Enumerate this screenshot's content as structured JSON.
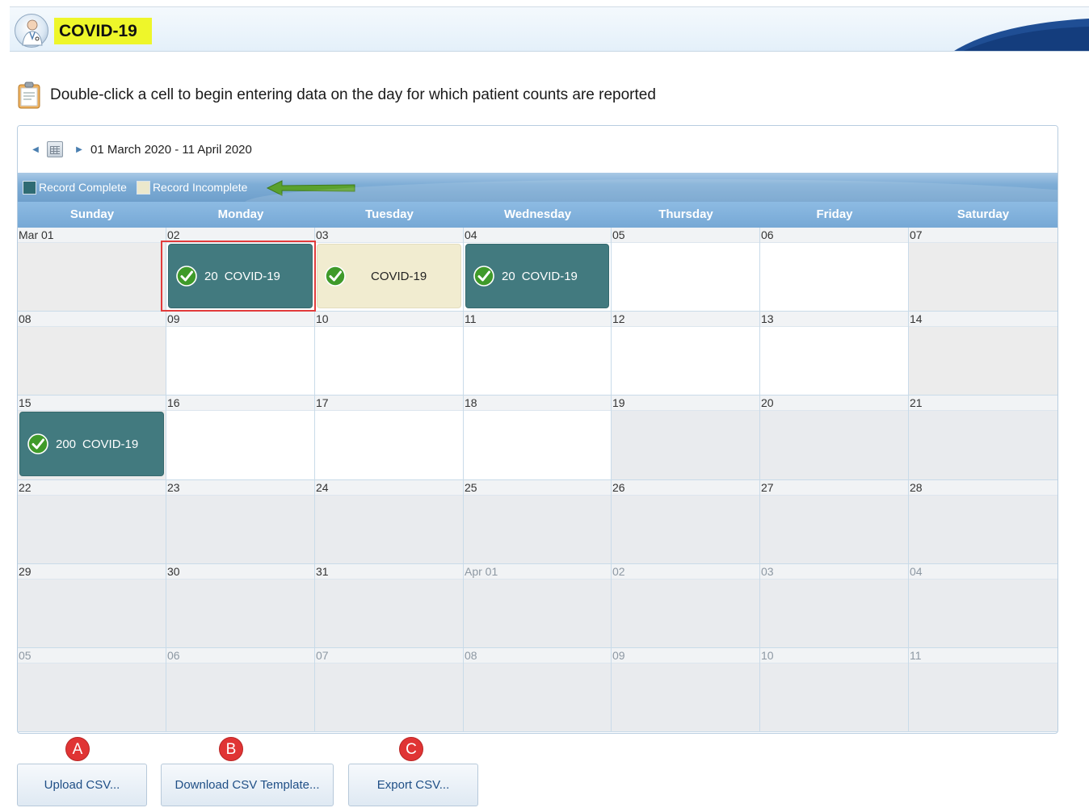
{
  "header": {
    "title": "COVID-19"
  },
  "instruction": {
    "text": "Double-click a cell to begin entering data on the day for which patient counts are reported"
  },
  "calendar": {
    "range": "01 March 2020 - 11 April 2020",
    "legend": [
      {
        "label": "Record Complete",
        "color": "#2f6b73"
      },
      {
        "label": "Record Incomplete",
        "color": "#ece8cc"
      }
    ],
    "days": [
      "Sunday",
      "Monday",
      "Tuesday",
      "Wednesday",
      "Thursday",
      "Friday",
      "Saturday"
    ],
    "weeks": [
      [
        {
          "label": "Mar 01",
          "bg": "gray"
        },
        {
          "label": "02",
          "bg": "white",
          "event": {
            "status": "complete",
            "count": "20",
            "name": "COVID-19"
          }
        },
        {
          "label": "03",
          "bg": "white",
          "event": {
            "status": "incomplete",
            "count": "",
            "name": "COVID-19"
          }
        },
        {
          "label": "04",
          "bg": "white",
          "event": {
            "status": "complete",
            "count": "20",
            "name": "COVID-19"
          }
        },
        {
          "label": "05",
          "bg": "white"
        },
        {
          "label": "06",
          "bg": "white"
        },
        {
          "label": "07",
          "bg": "gray"
        }
      ],
      [
        {
          "label": "08",
          "bg": "gray"
        },
        {
          "label": "09",
          "bg": "white"
        },
        {
          "label": "10",
          "bg": "white"
        },
        {
          "label": "11",
          "bg": "white"
        },
        {
          "label": "12",
          "bg": "white"
        },
        {
          "label": "13",
          "bg": "white"
        },
        {
          "label": "14",
          "bg": "gray"
        }
      ],
      [
        {
          "label": "15",
          "bg": "gray",
          "event": {
            "status": "complete",
            "count": "200",
            "name": "COVID-19"
          }
        },
        {
          "label": "16",
          "bg": "white"
        },
        {
          "label": "17",
          "bg": "white"
        },
        {
          "label": "18",
          "bg": "white"
        },
        {
          "label": "19",
          "bg": "gray-blue"
        },
        {
          "label": "20",
          "bg": "gray-blue"
        },
        {
          "label": "21",
          "bg": "gray-blue"
        }
      ],
      [
        {
          "label": "22",
          "bg": "gray-blue"
        },
        {
          "label": "23",
          "bg": "gray-blue"
        },
        {
          "label": "24",
          "bg": "gray-blue"
        },
        {
          "label": "25",
          "bg": "gray-blue"
        },
        {
          "label": "26",
          "bg": "gray-blue"
        },
        {
          "label": "27",
          "bg": "gray-blue"
        },
        {
          "label": "28",
          "bg": "gray-blue"
        }
      ],
      [
        {
          "label": "29",
          "bg": "gray-blue"
        },
        {
          "label": "30",
          "bg": "gray-blue"
        },
        {
          "label": "31",
          "bg": "gray-blue"
        },
        {
          "label": "Apr 01",
          "bg": "gray-blue",
          "other": true
        },
        {
          "label": "02",
          "bg": "gray-blue",
          "other": true
        },
        {
          "label": "03",
          "bg": "gray-blue",
          "other": true
        },
        {
          "label": "04",
          "bg": "gray-blue",
          "other": true
        }
      ],
      [
        {
          "label": "05",
          "bg": "gray-blue",
          "other": true
        },
        {
          "label": "06",
          "bg": "gray-blue",
          "other": true
        },
        {
          "label": "07",
          "bg": "gray-blue",
          "other": true
        },
        {
          "label": "08",
          "bg": "gray-blue",
          "other": true
        },
        {
          "label": "09",
          "bg": "gray-blue",
          "other": true
        },
        {
          "label": "10",
          "bg": "gray-blue",
          "other": true
        },
        {
          "label": "11",
          "bg": "gray-blue",
          "other": true
        }
      ]
    ]
  },
  "buttons": {
    "upload": "Upload CSV...",
    "download": "Download CSV Template...",
    "export": "Export CSV..."
  },
  "badges": {
    "a": "A",
    "b": "B",
    "c": "C"
  }
}
